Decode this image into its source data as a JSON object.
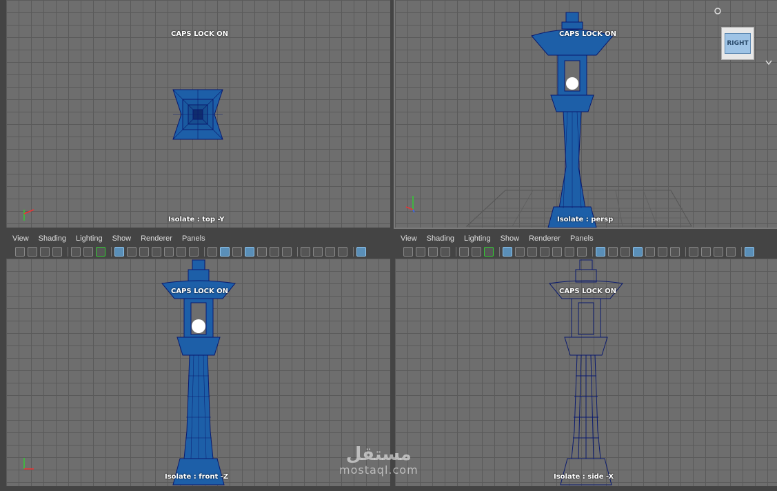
{
  "viewports": {
    "top": {
      "caps": "CAPS LOCK ON",
      "isolate": "Isolate : top -Y"
    },
    "persp": {
      "caps": "CAPS LOCK ON",
      "isolate": "Isolate : persp"
    },
    "front": {
      "caps": "CAPS LOCK ON",
      "isolate": "Isolate : front -Z"
    },
    "side": {
      "caps": "CAPS LOCK ON",
      "isolate": "Isolate : side -X"
    }
  },
  "panel_menu": [
    "View",
    "Shading",
    "Lighting",
    "Show",
    "Renderer",
    "Panels"
  ],
  "viewcube": {
    "label": "RIGHT"
  },
  "watermark": {
    "arabic": "مستقل",
    "latin": "mostaql.com"
  },
  "colors": {
    "mesh": "#1d5fa8",
    "wire": "#0a1a6e",
    "grid": "#5a5a5a",
    "background": "#6e6e6e"
  }
}
